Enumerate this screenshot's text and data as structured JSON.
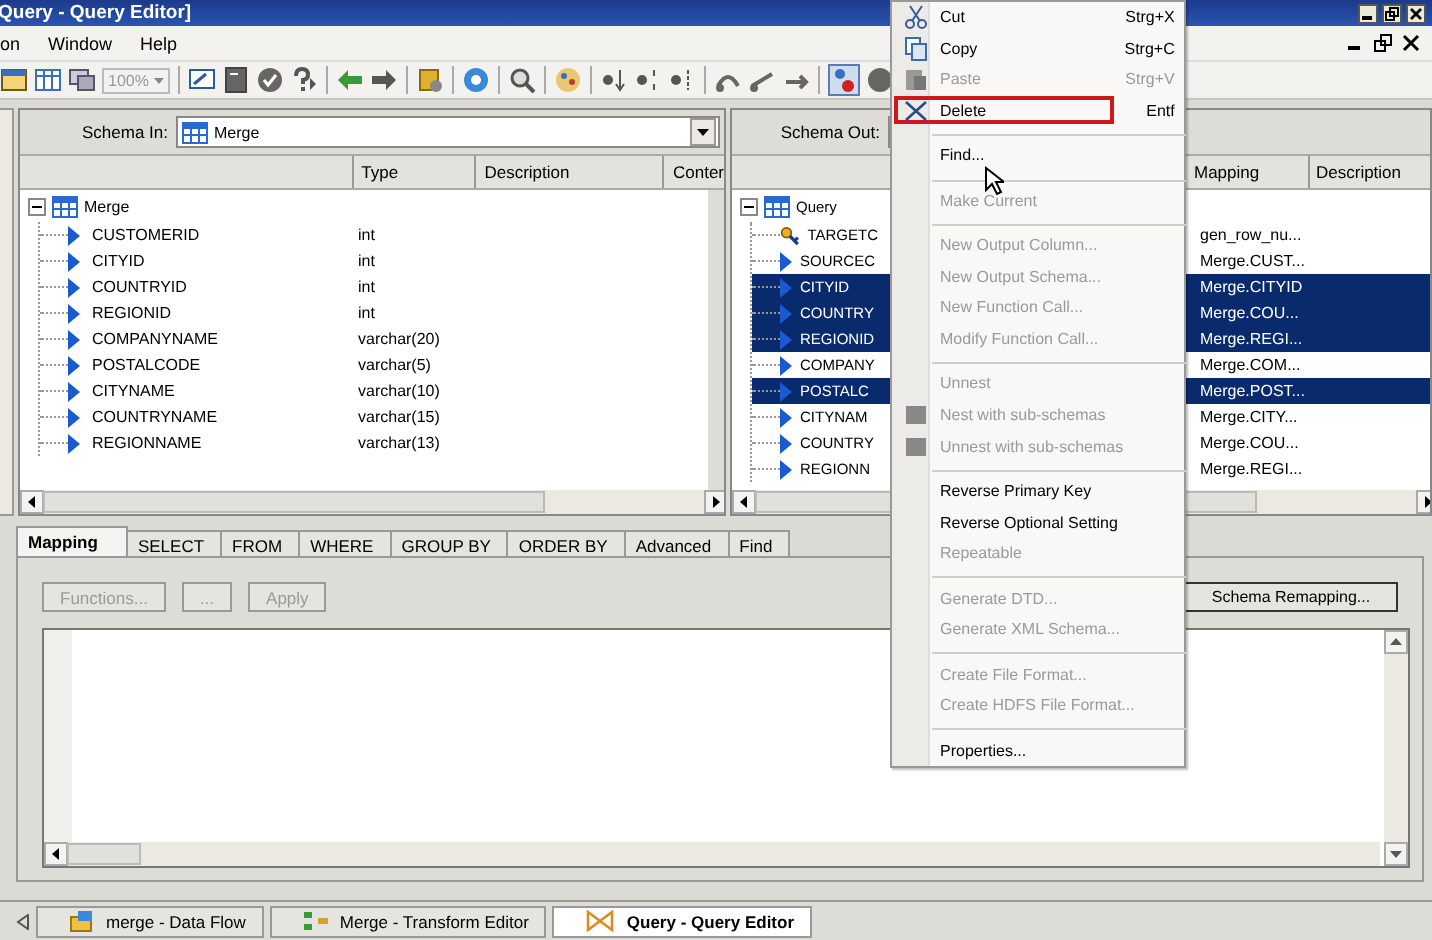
{
  "window": {
    "title": "Query - Query Editor]"
  },
  "menu_bar": [
    {
      "label": "on"
    },
    {
      "label": "Window"
    },
    {
      "label": "Help"
    }
  ],
  "toolbar": {
    "zoom": {
      "value": "100%",
      "disabled": true
    }
  },
  "schema_in": {
    "label": "Schema In:",
    "value": "Merge",
    "columns": [
      "Type",
      "Description",
      "Conter"
    ],
    "tree": {
      "name": "Merge",
      "expanded": true,
      "children": [
        {
          "name": "CUSTOMERID",
          "kind": "column",
          "type": "int"
        },
        {
          "name": "CITYID",
          "kind": "column",
          "type": "int"
        },
        {
          "name": "COUNTRYID",
          "kind": "column",
          "type": "int"
        },
        {
          "name": "REGIONID",
          "kind": "column",
          "type": "int"
        },
        {
          "name": "COMPANYNAME",
          "kind": "column",
          "type": "varchar(20)"
        },
        {
          "name": "POSTALCODE",
          "kind": "column",
          "type": "varchar(5)"
        },
        {
          "name": "CITYNAME",
          "kind": "column",
          "type": "varchar(10)"
        },
        {
          "name": "COUNTRYNAME",
          "kind": "column",
          "type": "varchar(15)"
        },
        {
          "name": "REGIONNAME",
          "kind": "column",
          "type": "varchar(13)"
        }
      ]
    }
  },
  "schema_out": {
    "label": "Schema Out:",
    "columns": [
      "Mapping",
      "Description"
    ],
    "tree": {
      "name": "Query",
      "expanded": true,
      "children": [
        {
          "name": "TARGETC",
          "kind": "key",
          "mapping": "gen_row_nu...",
          "selected": false
        },
        {
          "name": "SOURCEC",
          "kind": "column",
          "mapping": "Merge.CUST...",
          "selected": false
        },
        {
          "name": "CITYID",
          "kind": "column",
          "mapping": "Merge.CITYID",
          "selected": true
        },
        {
          "name": "COUNTRY",
          "kind": "column",
          "mapping": "Merge.COU...",
          "selected": true
        },
        {
          "name": "REGIONID",
          "kind": "column",
          "mapping": "Merge.REGI...",
          "selected": true
        },
        {
          "name": "COMPANY",
          "kind": "column",
          "mapping": "Merge.COM...",
          "selected": false
        },
        {
          "name": "POSTALC",
          "kind": "column",
          "mapping": "Merge.POST...",
          "selected": true
        },
        {
          "name": "CITYNAM",
          "kind": "column",
          "mapping": "Merge.CITY...",
          "selected": false
        },
        {
          "name": "COUNTRY",
          "kind": "column",
          "mapping": "Merge.COU...",
          "selected": false
        },
        {
          "name": "REGIONN",
          "kind": "column",
          "mapping": "Merge.REGI...",
          "selected": false
        }
      ]
    }
  },
  "tabs": [
    {
      "label": "Mapping",
      "selected": true
    },
    {
      "label": "SELECT",
      "selected": false
    },
    {
      "label": "FROM",
      "selected": false
    },
    {
      "label": "WHERE",
      "selected": false
    },
    {
      "label": "GROUP BY",
      "selected": false
    },
    {
      "label": "ORDER BY",
      "selected": false
    },
    {
      "label": "Advanced",
      "selected": false
    },
    {
      "label": "Find",
      "selected": false
    }
  ],
  "buttons": [
    {
      "label": "Functions...",
      "disabled": true
    },
    {
      "label": "...",
      "disabled": true
    },
    {
      "label": "Apply",
      "disabled": true
    }
  ],
  "schema_remapping_button": {
    "label": "Schema Remapping...",
    "disabled": false
  },
  "document_tabs": [
    {
      "label": "merge - Data Flow",
      "kind": "dataflow",
      "selected": false
    },
    {
      "label": "Merge - Transform Editor",
      "kind": "transform",
      "selected": false
    },
    {
      "label": "Query - Query Editor",
      "kind": "query",
      "selected": true
    }
  ],
  "context_menu": {
    "items": [
      {
        "kind": "command",
        "label": "Cut",
        "shortcut": "Strg+X",
        "disabled": false,
        "highlighted": false
      },
      {
        "kind": "command",
        "label": "Copy",
        "shortcut": "Strg+C",
        "disabled": false,
        "highlighted": false
      },
      {
        "kind": "command",
        "label": "Paste",
        "shortcut": "Strg+V",
        "disabled": true,
        "highlighted": false
      },
      {
        "kind": "command",
        "label": "Delete",
        "shortcut": "Entf",
        "disabled": false,
        "highlighted": true
      },
      {
        "kind": "separator"
      },
      {
        "kind": "command",
        "label": "Find...",
        "disabled": false,
        "highlighted": false
      },
      {
        "kind": "separator"
      },
      {
        "kind": "command",
        "label": "Make Current",
        "disabled": true,
        "highlighted": false
      },
      {
        "kind": "separator"
      },
      {
        "kind": "command",
        "label": "New Output Column...",
        "disabled": true,
        "highlighted": false
      },
      {
        "kind": "command",
        "label": "New Output Schema...",
        "disabled": true,
        "highlighted": false
      },
      {
        "kind": "command",
        "label": "New Function Call...",
        "disabled": true,
        "highlighted": false
      },
      {
        "kind": "command",
        "label": "Modify Function Call...",
        "disabled": true,
        "highlighted": false
      },
      {
        "kind": "separator"
      },
      {
        "kind": "command",
        "label": "Unnest",
        "disabled": true,
        "highlighted": false
      },
      {
        "kind": "command",
        "label": "Nest with sub-schemas",
        "disabled": true,
        "highlighted": false
      },
      {
        "kind": "command",
        "label": "Unnest with sub-schemas",
        "disabled": true,
        "highlighted": false
      },
      {
        "kind": "separator"
      },
      {
        "kind": "command",
        "label": "Reverse Primary Key",
        "disabled": false,
        "highlighted": false
      },
      {
        "kind": "command",
        "label": "Reverse Optional Setting",
        "disabled": false,
        "highlighted": false
      },
      {
        "kind": "command",
        "label": "Repeatable",
        "disabled": true,
        "highlighted": false
      },
      {
        "kind": "separator"
      },
      {
        "kind": "command",
        "label": "Generate DTD...",
        "disabled": true,
        "highlighted": false
      },
      {
        "kind": "command",
        "label": "Generate XML Schema...",
        "disabled": true,
        "highlighted": false
      },
      {
        "kind": "separator"
      },
      {
        "kind": "command",
        "label": "Create File Format...",
        "disabled": true,
        "highlighted": false
      },
      {
        "kind": "command",
        "label": "Create HDFS File Format...",
        "disabled": true,
        "highlighted": false
      },
      {
        "kind": "separator"
      },
      {
        "kind": "command",
        "label": "Properties...",
        "disabled": false,
        "highlighted": false
      }
    ]
  }
}
